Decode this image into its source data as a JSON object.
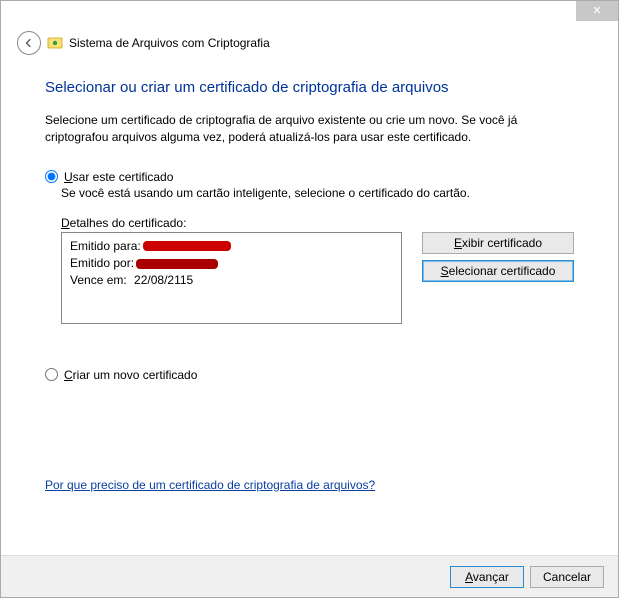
{
  "titlebar": {
    "close": "✕"
  },
  "header": {
    "app_title": "Sistema de Arquivos com Criptografia"
  },
  "page": {
    "title": "Selecionar ou criar um certificado de criptografia de arquivos",
    "description": "Selecione um certificado de criptografia de arquivo existente ou crie um novo. Se você já criptografou arquivos alguma vez, poderá atualizá-los para usar este certificado."
  },
  "option_use": {
    "prefix": "U",
    "rest": "sar este certificado",
    "sub": "Se você está usando um cartão inteligente, selecione o certificado do cartão.",
    "details_prefix": "D",
    "details_rest": "etalhes do certificado:"
  },
  "cert": {
    "issued_to_label": "Emitido para:",
    "issued_to_value": "",
    "issued_by_label": "Emitido por:",
    "issued_by_value": "",
    "expires_label": "Vence em:",
    "expires_value": "22/08/2115"
  },
  "buttons": {
    "view_prefix": "E",
    "view_rest": "xibir certificado",
    "select_prefix": "S",
    "select_rest": "elecionar certificado"
  },
  "option_new": {
    "prefix": "C",
    "rest": "riar um novo certificado"
  },
  "help_link": "Por que preciso de um certificado de criptografia de arquivos?",
  "footer": {
    "next_prefix": "A",
    "next_rest": "vançar",
    "cancel": "Cancelar"
  }
}
